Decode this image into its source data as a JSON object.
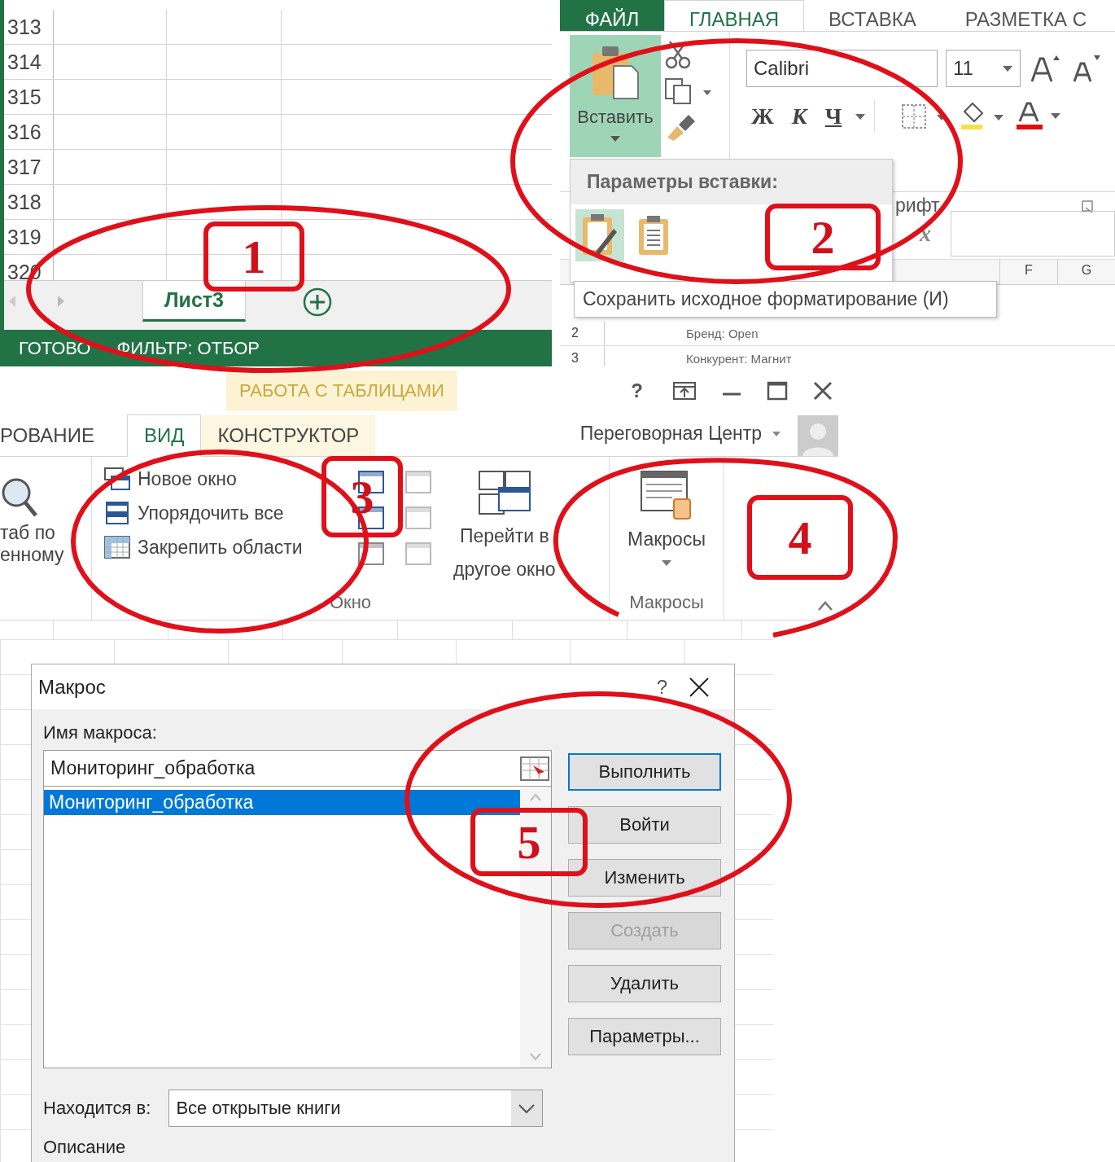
{
  "sheet_panel": {
    "row_headers": [
      "313",
      "314",
      "315",
      "316",
      "317",
      "318",
      "319",
      "320"
    ],
    "sheet_tabs": [
      {
        "label": "Лист3",
        "selected": true
      }
    ],
    "status_bar": [
      "ГОТОВО",
      "ФИЛЬТР: ОТБОР"
    ]
  },
  "home_ribbon": {
    "tabs": [
      {
        "label": "ФАЙЛ",
        "selected": false,
        "kind": "file"
      },
      {
        "label": "ГЛАВНАЯ",
        "selected": true,
        "kind": "tab"
      },
      {
        "label": "ВСТАВКА",
        "selected": false,
        "kind": "tab"
      },
      {
        "label": "РАЗМЕТКА С",
        "selected": false,
        "kind": "tab"
      }
    ],
    "paste_button": "Вставить",
    "font_name": "Calibri",
    "font_size": "11",
    "format_buttons": [
      "Ж",
      "К",
      "Ч"
    ],
    "group_label": "рифт",
    "paste_menu": {
      "title": "Параметры вставки:"
    },
    "formula_symbol": "x",
    "tooltip": "Сохранить исходное форматирование (И)",
    "column_headers": [
      "F",
      "G"
    ],
    "rows": [
      {
        "header": "2",
        "cell": "Бренд: Open"
      },
      {
        "header": "3",
        "cell": "Конкурент: Магнит"
      }
    ]
  },
  "view_ribbon": {
    "context_title": "РАБОТА С ТАБЛИЦАМИ",
    "help": "?",
    "tabs": [
      {
        "label": "РОВАНИЕ",
        "selected": false,
        "kind": "tab"
      },
      {
        "label": "ВИД",
        "selected": true,
        "kind": "tab"
      },
      {
        "label": "КОНСТРУКТОР",
        "selected": false,
        "kind": "context"
      }
    ],
    "account": "Переговорная Центр",
    "zoom_label": [
      "таб по",
      "енному"
    ],
    "window_commands": [
      "Новое окно",
      "Упорядочить все",
      "Закрепить области"
    ],
    "switch_window": [
      "Перейти в",
      "другое окно"
    ],
    "window_group": "Окно",
    "macros_button": "Макросы",
    "macros_group": "Макросы"
  },
  "macro_dialog": {
    "title": "Макрос",
    "help": "?",
    "name_label": "Имя макроса:",
    "name_value": "Мониторинг_обработка",
    "macros": [
      {
        "name": "Мониторинг_обработка",
        "selected": true
      }
    ],
    "buttons": [
      {
        "label": "Выполнить",
        "disabled": false,
        "default": true
      },
      {
        "label": "Войти",
        "disabled": false,
        "default": false
      },
      {
        "label": "Изменить",
        "disabled": false,
        "default": false
      },
      {
        "label": "Создать",
        "disabled": true,
        "default": false
      },
      {
        "label": "Удалить",
        "disabled": false,
        "default": false
      },
      {
        "label": "Параметры...",
        "disabled": false,
        "default": false
      }
    ],
    "location_label": "Находится в:",
    "location_value": "Все открытые книги",
    "description_label": "Описание"
  },
  "annotations": [
    {
      "number": "1"
    },
    {
      "number": "2"
    },
    {
      "number": "3"
    },
    {
      "number": "4"
    },
    {
      "number": "5"
    }
  ]
}
